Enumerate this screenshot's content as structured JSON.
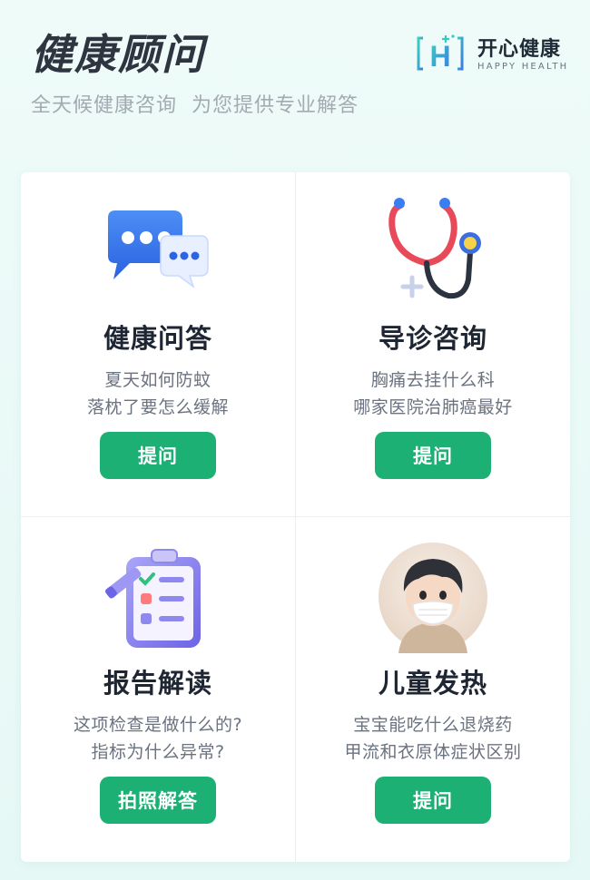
{
  "header": {
    "title": "健康顾问",
    "subtitle": "全天候健康咨询  为您提供专业解答",
    "brand": {
      "name": "开心健康",
      "sub": "HAPPY HEALTH",
      "logo_letter": "H"
    }
  },
  "colors": {
    "accent": "#1cb074",
    "brand_teal": "#3cc8c0"
  },
  "cards": [
    {
      "icon": "chat-bubbles-icon",
      "title": "健康问答",
      "desc1": "夏天如何防蚊",
      "desc2": "落枕了要怎么缓解",
      "button": "提问"
    },
    {
      "icon": "stethoscope-icon",
      "title": "导诊咨询",
      "desc1": "胸痛去挂什么科",
      "desc2": "哪家医院治肺癌最好",
      "button": "提问"
    },
    {
      "icon": "clipboard-report-icon",
      "title": "报告解读",
      "desc1": "这项检查是做什么的?",
      "desc2": "指标为什么异常?",
      "button": "拍照解答"
    },
    {
      "icon": "child-mask-avatar-icon",
      "title": "儿童发热",
      "desc1": "宝宝能吃什么退烧药",
      "desc2": "甲流和衣原体症状区别",
      "button": "提问"
    }
  ]
}
